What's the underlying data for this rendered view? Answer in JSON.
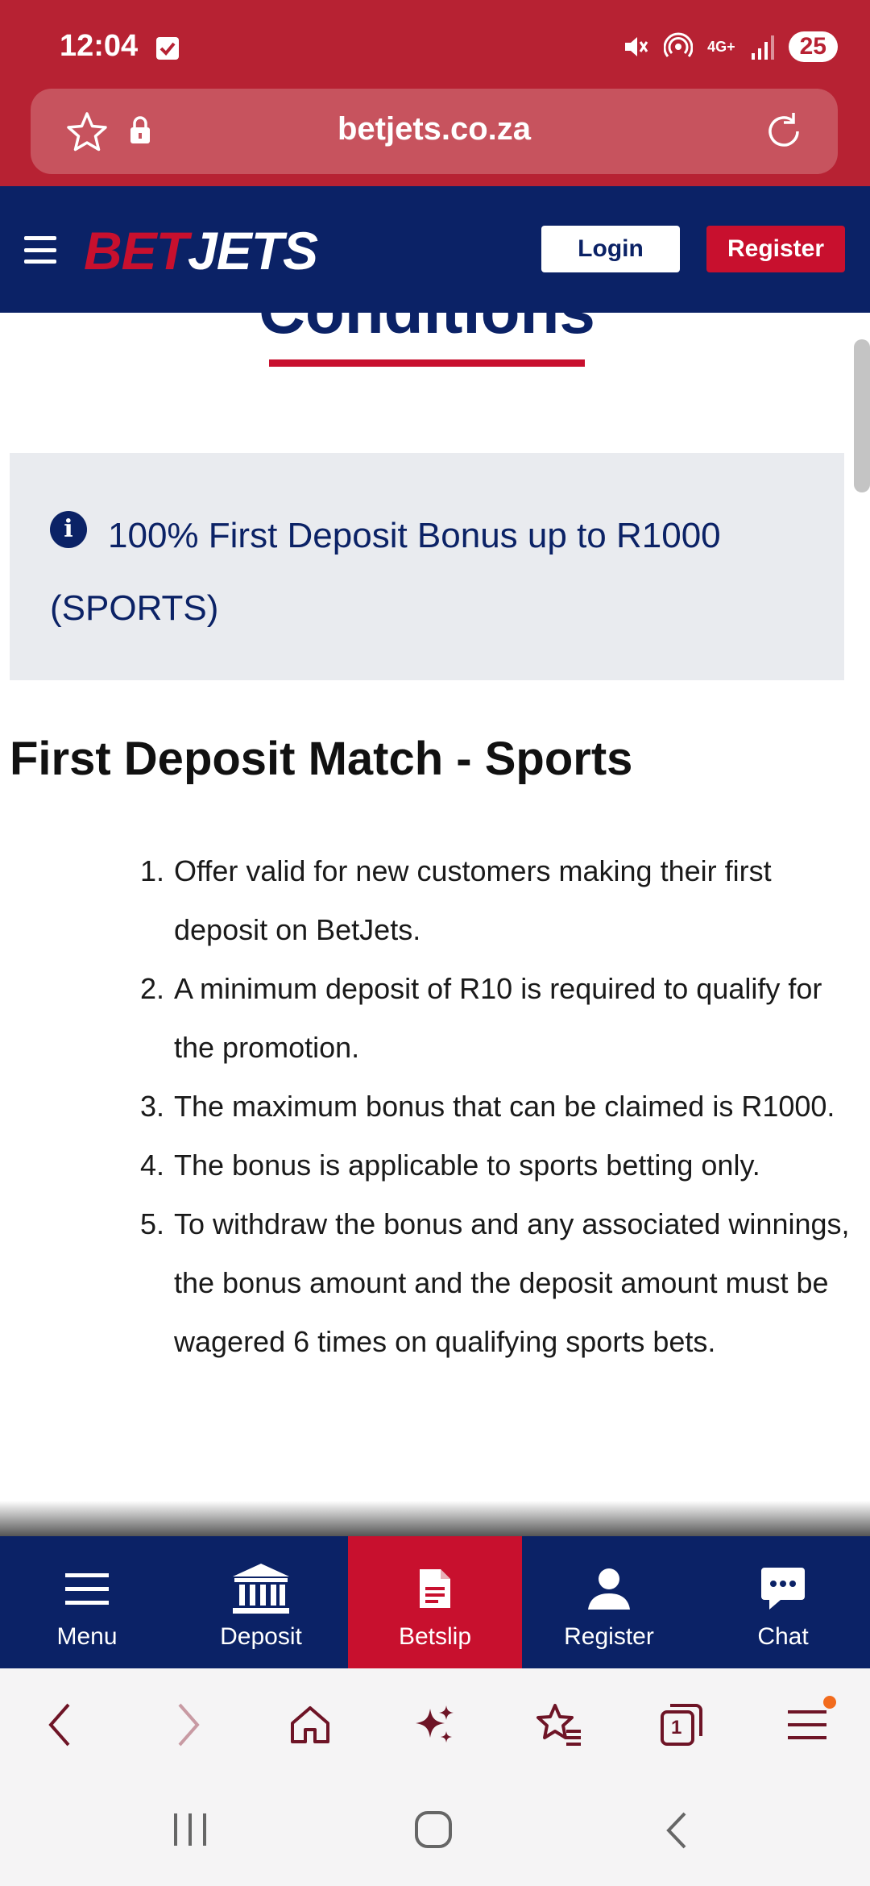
{
  "status_bar": {
    "time": "12:04",
    "network": "4G+",
    "battery": "25"
  },
  "browser": {
    "url": "betjets.co.za"
  },
  "header": {
    "logo_part1": "BET",
    "logo_part2": "JETS",
    "login_label": "Login",
    "register_label": "Register"
  },
  "page": {
    "cut_title": "Conditions",
    "info_banner": "100% First Deposit Bonus up to R1000 (SPORTS)",
    "section_title": "First Deposit Match - Sports",
    "terms": [
      {
        "num": "1.",
        "text": "Offer valid for new customers making their first deposit on BetJets."
      },
      {
        "num": "2.",
        "text": "A minimum deposit of R10 is required to qualify for the promotion."
      },
      {
        "num": "3.",
        "text": "The maximum bonus that can be claimed is R1000."
      },
      {
        "num": "4.",
        "text": "The bonus is applicable to sports betting only."
      },
      {
        "num": "5.",
        "text": "To withdraw the bonus and any associated winnings, the bonus amount and the deposit amount must be wagered 6 times on qualifying sports bets."
      }
    ]
  },
  "bottom_nav": {
    "items": [
      {
        "label": "Menu",
        "icon": "menu-icon"
      },
      {
        "label": "Deposit",
        "icon": "bank-icon"
      },
      {
        "label": "Betslip",
        "icon": "document-icon",
        "active": true
      },
      {
        "label": "Register",
        "icon": "user-icon"
      },
      {
        "label": "Chat",
        "icon": "chat-icon"
      }
    ]
  },
  "browser_toolbar": {
    "tab_count": "1"
  },
  "colors": {
    "brand_navy": "#0b2266",
    "brand_red": "#c8102e",
    "browser_red": "#b72233"
  }
}
